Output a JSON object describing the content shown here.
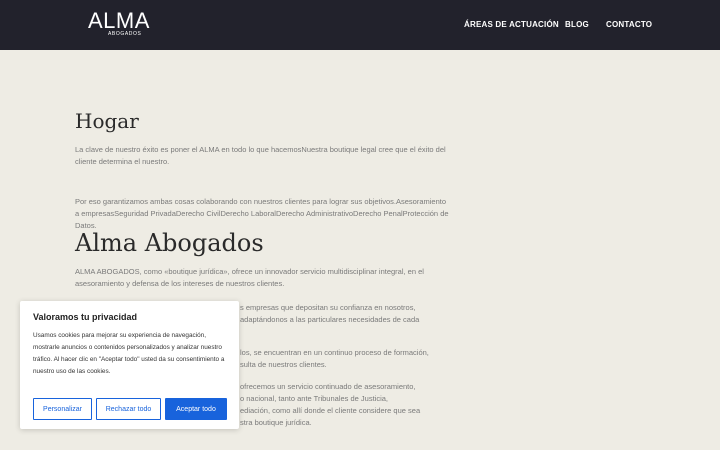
{
  "header": {
    "logo_text": "ALMA",
    "logo_subtext": "ABOGADOS",
    "nav": [
      "ÁREAS DE ACTUACIÓN",
      "BLOG",
      "CONTACTO"
    ]
  },
  "main": {
    "hogar_title": "Hogar",
    "hogar_p1": "La clave de nuestro éxito es poner el ALMA en todo lo que hacemosNuestra boutique legal cree que el éxito del cliente determina el nuestro.",
    "hogar_p2": "Por eso garantizamos ambas cosas colaborando con nuestros clientes para lograr sus objetivos.Asesoramiento a empresasSeguridad PrivadaDerecho CivilDerecho LaboralDerecho AdministrativoDerecho PenalProtección de Datos.",
    "alma_title": "Alma Abogados",
    "alma_intro": "ALMA ABOGADOS, como «boutique jurídica», ofrece un innovador servicio multidisciplinar integral, en el asesoramiento y defensa de los intereses de nuestros clientes.",
    "frag_1": "s empresas que depositan su confianza en nosotros,",
    "frag_2": "adaptándonos a las particulares necesidades de cada",
    "frag_3": "los, se encuentran en un continuo proceso de formación,",
    "frag_4": "sulta de nuestros clientes.",
    "frag_5": "ofrecemos un servicio continuado de asesoramiento,",
    "frag_6": "o nacional, tanto ante Tribunales de Justicia,",
    "frag_7": "ediación, como allí donde el cliente considere que sea",
    "frag_8": "stra boutique jurídica."
  },
  "cookie": {
    "title": "Valoramos tu privacidad",
    "text": "Usamos cookies para mejorar su experiencia de navegación, mostrarle anuncios o contenidos personalizados y analizar nuestro tráfico. Al hacer clic en \"Aceptar todo\" usted da su consentimiento a nuestro uso de las cookies.",
    "btn_customize": "Personalizar",
    "btn_reject": "Rechazar todo",
    "btn_accept": "Aceptar todo"
  },
  "colors": {
    "topbar": "#22222c",
    "background": "#eeece4",
    "accent": "#1863dc"
  }
}
